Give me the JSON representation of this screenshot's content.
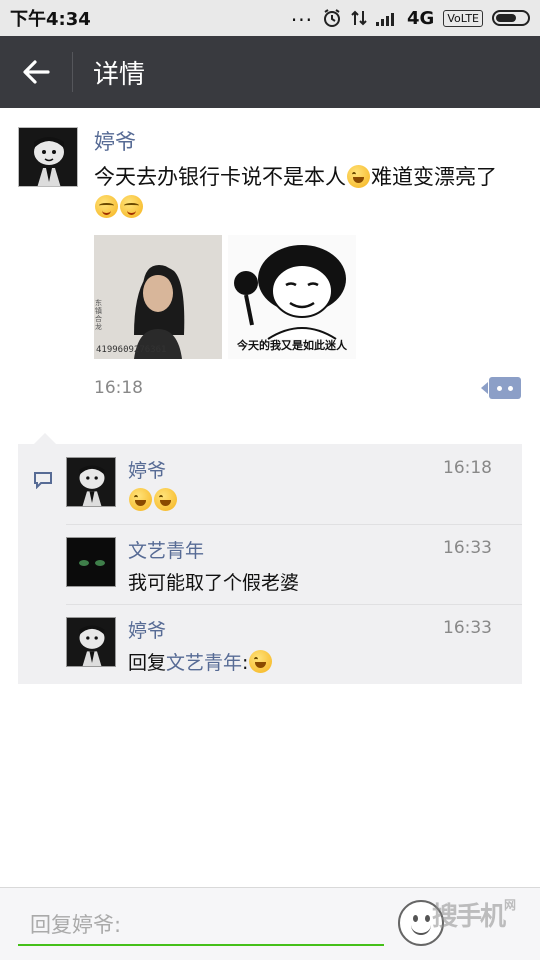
{
  "status_bar": {
    "time": "下午4:34",
    "dots": "...",
    "network": "4G",
    "volte": "VoLTE"
  },
  "header": {
    "title": "详情",
    "back_icon": "arrow-left-icon"
  },
  "post": {
    "author": "婷爷",
    "text_part1": "今天去办银行卡说不是本人",
    "text_part2": "难道变漂亮了",
    "emojis": [
      "laugh-cry-emoji",
      "blush-emoji",
      "blush-emoji"
    ],
    "image_id_number": "4199609276361",
    "image_id_side": "东镇合龙",
    "meme_caption": "今天的我又是如此迷人",
    "time": "16:18"
  },
  "comments": [
    {
      "name": "婷爷",
      "time": "16:18",
      "text": "",
      "emojis": [
        "laugh-cry-emoji",
        "laugh-cry-emoji"
      ]
    },
    {
      "name": "文艺青年",
      "time": "16:33",
      "text": "我可能取了个假老婆"
    },
    {
      "name": "婷爷",
      "time": "16:33",
      "text_prefix": "回复",
      "text_link": "文艺青年",
      "text_suffix": ":",
      "emojis": [
        "laugh-cry-emoji"
      ]
    }
  ],
  "input": {
    "placeholder": "回复婷爷:"
  },
  "watermark": {
    "text": "搜手机",
    "small": "网"
  },
  "colors": {
    "title_bar": "#393a3f",
    "link": "#576b95",
    "input_underline": "#45c01a",
    "comment_bg": "#f0f0f2"
  }
}
